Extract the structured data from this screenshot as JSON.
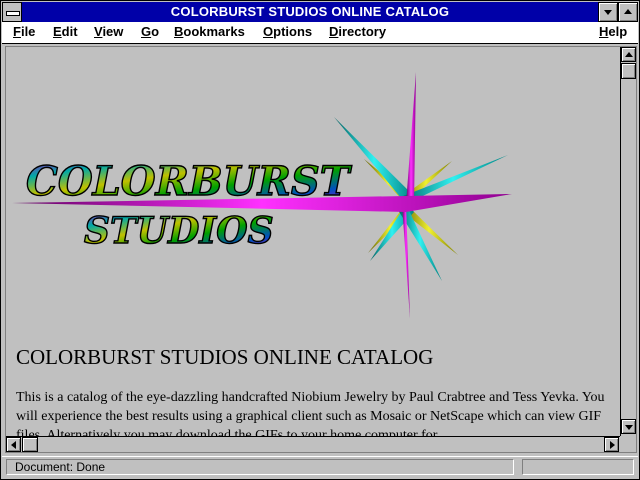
{
  "window": {
    "title": "COLORBURST STUDIOS ONLINE CATALOG"
  },
  "menu": {
    "items": [
      {
        "label": "File",
        "accel": "F",
        "rest": "ile"
      },
      {
        "label": "Edit",
        "accel": "E",
        "rest": "dit"
      },
      {
        "label": "View",
        "accel": "V",
        "rest": "iew"
      },
      {
        "label": "Go",
        "accel": "G",
        "rest": "o"
      },
      {
        "label": "Bookmarks",
        "accel": "B",
        "rest": "ookmarks"
      },
      {
        "label": "Options",
        "accel": "O",
        "rest": "ptions"
      },
      {
        "label": "Directory",
        "accel": "D",
        "rest": "irectory"
      },
      {
        "label": "Help",
        "accel": "H",
        "rest": "elp"
      }
    ]
  },
  "page": {
    "logo": {
      "line1": "COLORBURST",
      "line2": "STUDIOS"
    },
    "heading": "COLORBURST STUDIOS ONLINE CATALOG",
    "paragraph": "This is a catalog of the eye-dazzling handcrafted Niobium Jewelry by Paul Crabtree and Tess Yevka. You will experience the best results using a graphical client such as Mosaic or NetScape which can view GIF files. Alternatively you may download the GIFs to your home computer for"
  },
  "status": {
    "text": "Document: Done",
    "progress": 0
  },
  "colors": {
    "titlebar": "#0000a8",
    "chrome": "#c0c0c0",
    "star_magenta": "#c000c0",
    "star_teal": "#00a8a8",
    "star_olive": "#b8b800"
  }
}
